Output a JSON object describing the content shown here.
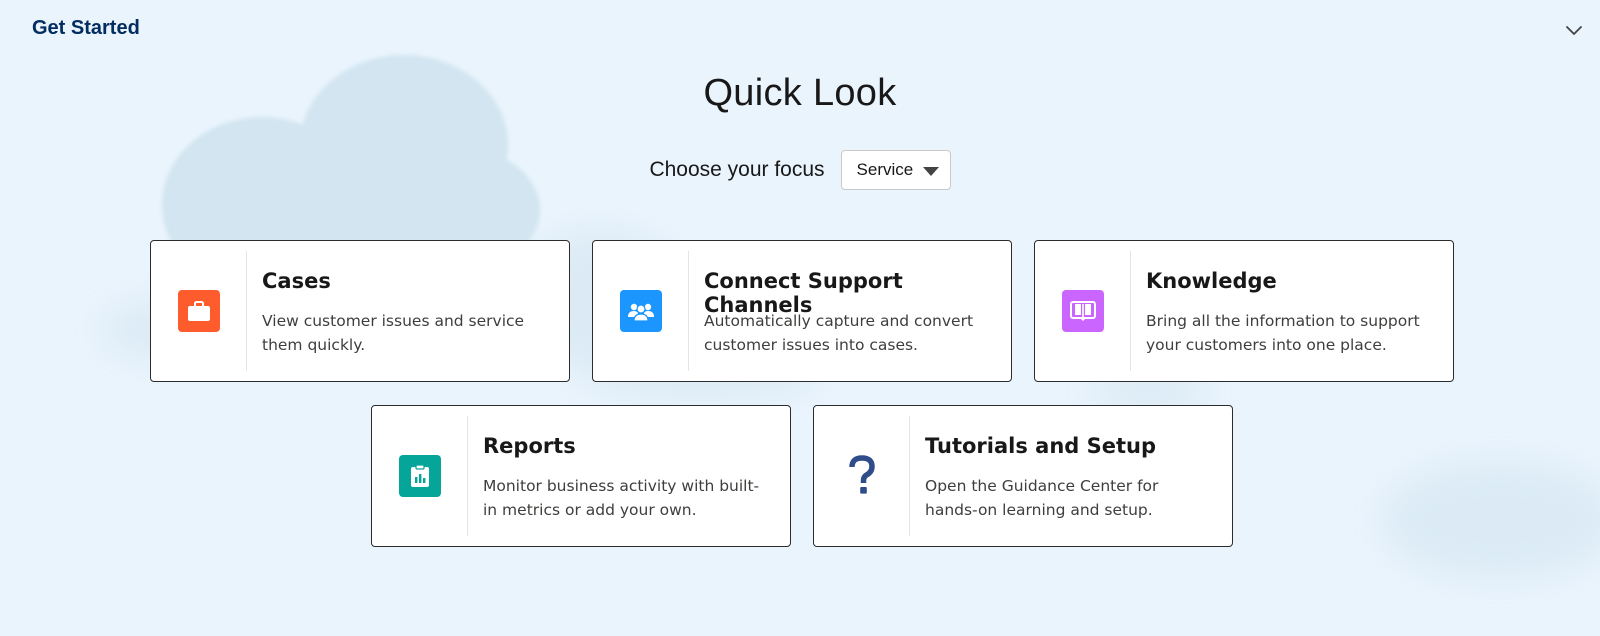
{
  "header": {
    "title": "Get Started",
    "collapse_icon": "chevron-down-icon"
  },
  "main": {
    "title": "Quick Look",
    "focus_label": "Choose your focus",
    "focus_value": "Service"
  },
  "cards": [
    {
      "title": "Cases",
      "description": "View customer issues and service them quickly.",
      "icon": "briefcase-icon",
      "color": "#fe5c2c"
    },
    {
      "title": "Connect Support Channels",
      "description": "Automatically capture and convert customer issues into cases.",
      "icon": "users-icon",
      "color": "#1b96ff"
    },
    {
      "title": "Knowledge",
      "description": "Bring all the information to support your customers into one place.",
      "icon": "book-icon",
      "color": "#cb65ff"
    },
    {
      "title": "Reports",
      "description": "Monitor business activity with built-in metrics or add your own.",
      "icon": "report-icon",
      "color": "#06a59a"
    },
    {
      "title": "Tutorials and Setup",
      "description": "Open the Guidance Center for hands-on learning and setup.",
      "icon": "question-icon",
      "color": "#2e4d8a"
    }
  ]
}
